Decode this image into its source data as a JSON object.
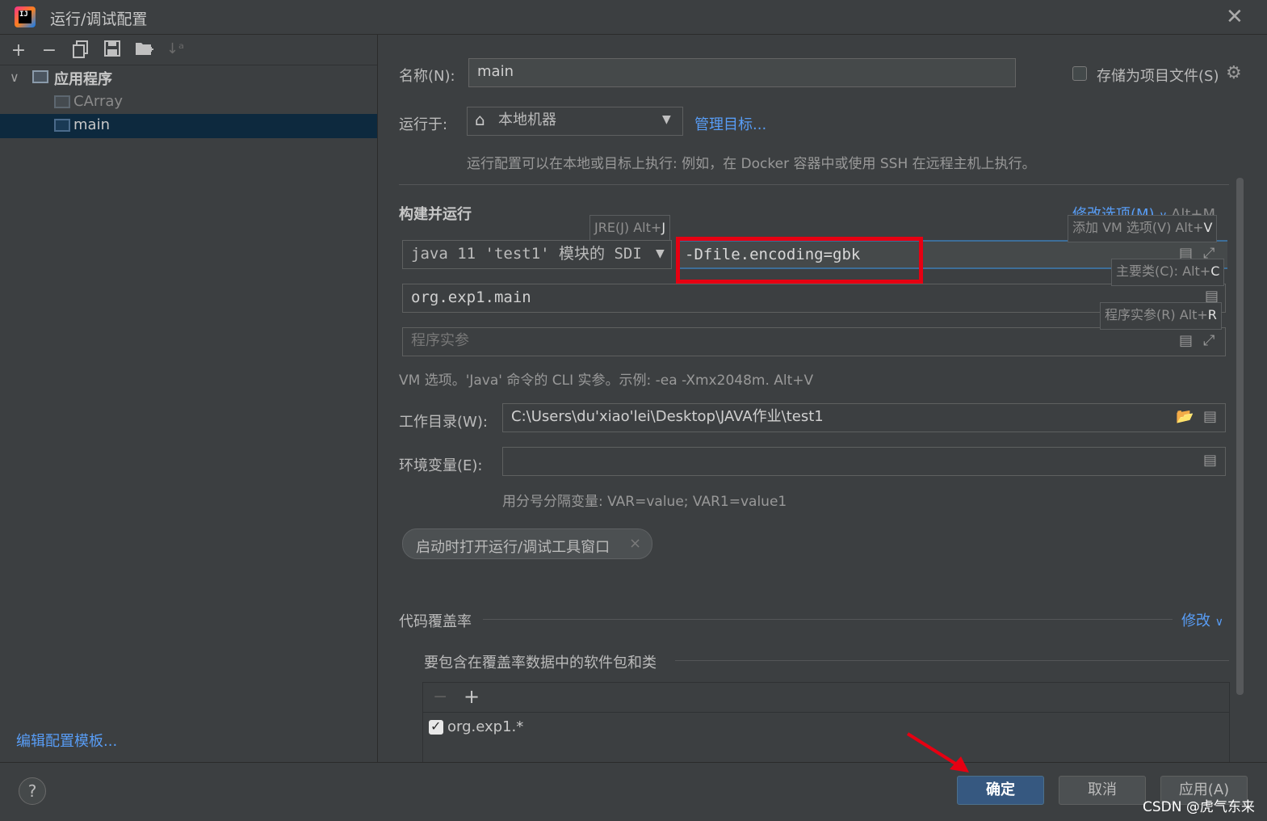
{
  "window": {
    "title": "运行/调试配置",
    "close_glyph": "✕"
  },
  "toolbar": {
    "icons": [
      "add-icon",
      "remove-icon",
      "copy-icon",
      "save-icon",
      "new-folder-icon",
      "sort-icon"
    ]
  },
  "tree": {
    "group_label": "应用程序",
    "items": [
      {
        "label": "CArray",
        "selected": false
      },
      {
        "label": "main",
        "selected": true
      }
    ],
    "edit_templates": "编辑配置模板..."
  },
  "form": {
    "name_label": "名称(N):",
    "name_value": "main",
    "store_as_project": "存储为项目文件(S)",
    "run_on_label": "运行于:",
    "run_on_value": "本地机器",
    "manage_targets": "管理目标...",
    "run_on_hint": "运行配置可以在本地或目标上执行: 例如，在 Docker 容器中或使用 SSH 在远程主机上执行。",
    "build_run_title": "构建并运行",
    "modify_options": "修改选项(M)",
    "modify_options_shortcut": "Alt+M",
    "jre_tooltip_text": "JRE(J) Alt+",
    "jre_tooltip_key": "J",
    "jre_value": "java 11 'test1' 模块的 SDI",
    "vm_options_value": "-Dfile.encoding=gbk",
    "vm_tooltip_text": "添加 VM 选项(V) Alt+",
    "vm_tooltip_key": "V",
    "main_class_value": "org.exp1.main",
    "main_class_tooltip_text": "主要类(C): Alt+",
    "main_class_tooltip_key": "C",
    "program_args_placeholder": "程序实参",
    "program_args_tooltip_text": "程序实参(R) Alt+",
    "program_args_tooltip_key": "R",
    "vm_hint": "VM 选项。'Java' 命令的 CLI 实参。示例: -ea -Xmx2048m. Alt+V",
    "workdir_label": "工作目录(W):",
    "workdir_value": "C:\\Users\\du'xiao'lei\\Desktop\\JAVA作业\\test1",
    "env_label": "环境变量(E):",
    "env_value": "",
    "env_hint": "用分号分隔变量: VAR=value; VAR1=value1",
    "chip_label": "启动时打开运行/调试工具窗口",
    "coverage_title": "代码覆盖率",
    "coverage_modify": "修改",
    "coverage_include_title": "要包含在覆盖率数据中的软件包和类",
    "coverage_item": "org.exp1.*"
  },
  "buttons": {
    "ok": "确定",
    "cancel": "取消",
    "apply": "应用(A)",
    "help": "?"
  },
  "watermark": "CSDN @虎气东来",
  "colors": {
    "accent_link": "#589df6",
    "highlight_box": "#e60012",
    "selected_row": "#0d293e",
    "primary_button": "#365880"
  }
}
